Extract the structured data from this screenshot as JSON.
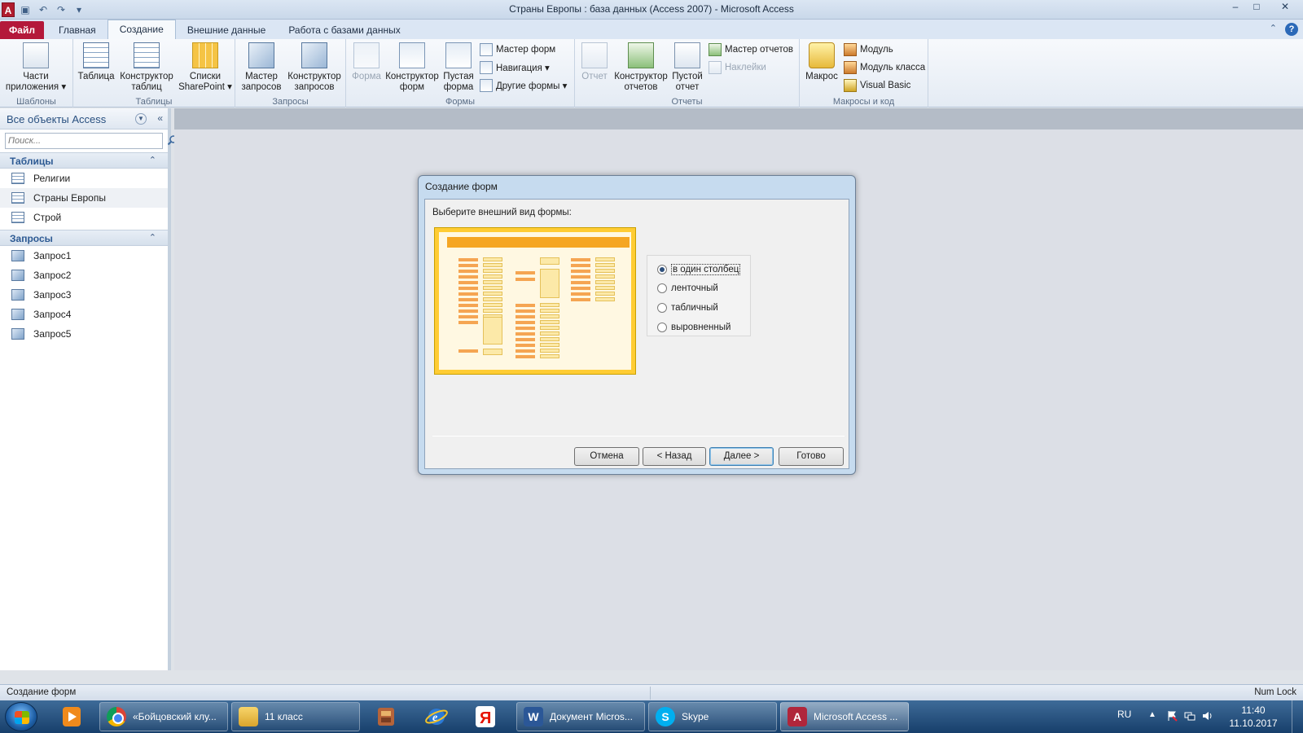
{
  "window": {
    "title": "Страны Европы : база данных (Access 2007)  -  Microsoft Access",
    "app_icon_letter": "A",
    "controls": [
      "–",
      "□",
      "✕"
    ]
  },
  "ribbon": {
    "tabs": [
      "Файл",
      "Главная",
      "Создание",
      "Внешние данные",
      "Работа с базами данных"
    ],
    "active_tab": "Создание",
    "groups": {
      "templates": {
        "label": "Шаблоны",
        "parts_line1": "Части",
        "parts_line2": "приложения ▾"
      },
      "tables": {
        "label": "Таблицы",
        "table": "Таблица",
        "designer_l1": "Конструктор",
        "designer_l2": "таблиц",
        "sp_l1": "Списки",
        "sp_l2": "SharePoint ▾"
      },
      "queries": {
        "label": "Запросы",
        "wizard_l1": "Мастер",
        "wizard_l2": "запросов",
        "designer_l1": "Конструктор",
        "designer_l2": "запросов"
      },
      "forms": {
        "label": "Формы",
        "form": "Форма",
        "designer_l1": "Конструктор",
        "designer_l2": "форм",
        "blank_l1": "Пустая",
        "blank_l2": "форма",
        "wizard": "Мастер форм",
        "navigation": "Навигация ▾",
        "other": "Другие формы ▾"
      },
      "reports": {
        "label": "Отчеты",
        "report": "Отчет",
        "designer_l1": "Конструктор",
        "designer_l2": "отчетов",
        "blank_l1": "Пустой",
        "blank_l2": "отчет",
        "wizard": "Мастер отчетов",
        "labels": "Наклейки"
      },
      "macros": {
        "label": "Макросы и код",
        "macro": "Макрос",
        "module": "Модуль",
        "class_module": "Модуль класса",
        "vb": "Visual Basic"
      }
    }
  },
  "nav": {
    "title": "Все объекты Access",
    "search_placeholder": "Поиск...",
    "sections": [
      {
        "title": "Таблицы",
        "items": [
          "Религии",
          "Страны Европы",
          "Строй"
        ]
      },
      {
        "title": "Запросы",
        "items": [
          "Запрос1",
          "Запрос2",
          "Запрос3",
          "Запрос4",
          "Запрос5"
        ]
      }
    ]
  },
  "dialog": {
    "title": "Создание форм",
    "prompt": "Выберите внешний вид формы:",
    "options": [
      "в один столбец",
      "ленточный",
      "табличный",
      "выровненный"
    ],
    "selected": "в один столбец",
    "buttons": {
      "cancel": "Отмена",
      "back": "< Назад",
      "next": "Далее >",
      "finish": "Готово"
    }
  },
  "status": {
    "left": "Создание форм",
    "right": "Num Lock"
  },
  "taskbar": {
    "tasks": [
      "«Бойцовский клу...",
      "11 класс",
      "Документ Micros...",
      "Skype",
      "Microsoft Access ..."
    ],
    "lang": "RU",
    "time": "11:40",
    "date": "11.10.2017"
  },
  "colors": {
    "file_tab": "#b4183a",
    "preview_border": "#ffcc33",
    "taskbar": "#173f6b"
  }
}
